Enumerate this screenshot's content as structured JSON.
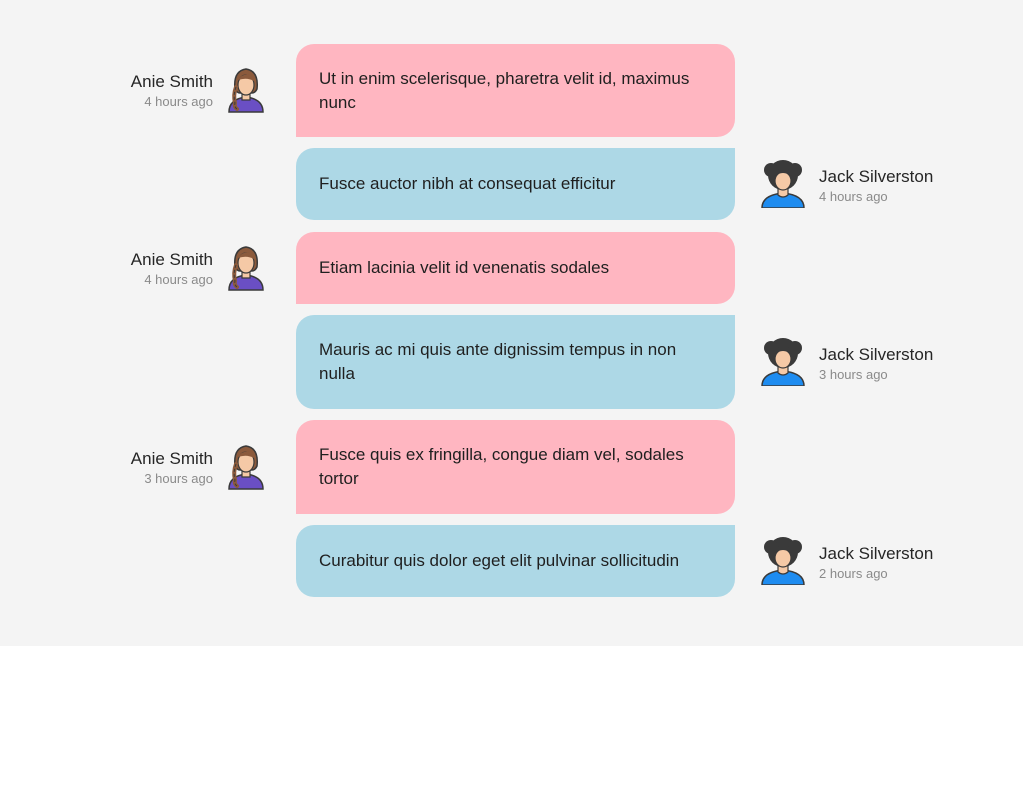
{
  "chat": {
    "messages": [
      {
        "author": "Anie Smith",
        "time": "4 hours ago",
        "text": "Ut in enim scelerisque, pharetra velit id, maximus nunc"
      },
      {
        "author": "Jack Silverston",
        "time": "4 hours ago",
        "text": "Fusce auctor nibh at consequat efficitur"
      },
      {
        "author": "Anie Smith",
        "time": "4 hours ago",
        "text": "Etiam lacinia velit id venenatis sodales"
      },
      {
        "author": "Jack Silverston",
        "time": "3 hours ago",
        "text": "Mauris ac mi quis ante dignissim tempus in non nulla"
      },
      {
        "author": "Anie Smith",
        "time": "3 hours ago",
        "text": "Fusce quis ex fringilla, congue diam vel, sodales tortor"
      },
      {
        "author": "Jack Silverston",
        "time": "2 hours ago",
        "text": "Curabitur quis dolor eget elit pulvinar sollicitudin"
      }
    ]
  },
  "colors": {
    "anie_bubble": "#ffb6c1",
    "jack_bubble": "#add8e6",
    "panel_background": "#f4f4f4",
    "anie_shirt": "#6a4fc4",
    "jack_shirt": "#1e8cf0"
  },
  "icons": {
    "anie_avatar": "female-avatar-icon",
    "jack_avatar": "male-avatar-icon"
  }
}
